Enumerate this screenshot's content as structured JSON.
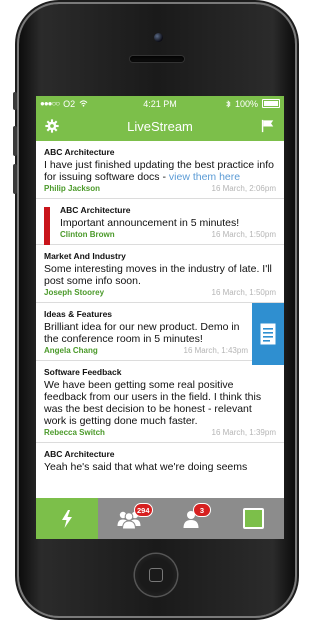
{
  "status_bar": {
    "signal": "●●●○○",
    "carrier": "O2",
    "time": "4:21 PM",
    "battery": "100%"
  },
  "nav": {
    "title": "LiveStream"
  },
  "feed": [
    {
      "category": "ABC Architecture",
      "message": "I have just finished updating the best practice info for issuing software docs - ",
      "link": "view them here",
      "author": "Philip Jackson",
      "date": "16 March, 2:06pm"
    },
    {
      "category": "ABC Architecture",
      "message": "Important announcement in 5 minutes!",
      "author": "Clinton Brown",
      "date": "16 March, 1:50pm"
    },
    {
      "category": "Market And Industry",
      "message": "Some interesting moves in the industry of late. I'll post some info soon.",
      "author": "Joseph Stoorey",
      "date": "16 March, 1:50pm"
    },
    {
      "category": "Ideas & Features",
      "message": "Brilliant idea for our new product. Demo in the conference room in 5 minutes!",
      "author": "Angela Chang",
      "date": "16 March, 1:43pm"
    },
    {
      "category": "Software Feedback",
      "message": "We have been getting some real positive feedback from our users in the field. I think this was the best decision to be honest - relevant work is getting done much faster.",
      "author": "Rebecca Switch",
      "date": "16 March, 1:39pm"
    },
    {
      "category": "ABC Architecture",
      "message": "Yeah he's said that what we're doing seems",
      "author": "",
      "date": ""
    }
  ],
  "tabs": {
    "groups_badge": "294",
    "contacts_badge": "3"
  },
  "colors": {
    "brand_green": "#7cbf4a",
    "alert_red": "#c9151b",
    "doc_blue": "#2f8fd0",
    "author_green": "#4b9a2a"
  },
  "icons": {
    "settings": "gear-icon",
    "flag": "flag-icon",
    "stream": "lightning-icon",
    "groups": "group-icon",
    "contacts": "person-icon",
    "square": "square-icon",
    "document": "document-icon"
  }
}
